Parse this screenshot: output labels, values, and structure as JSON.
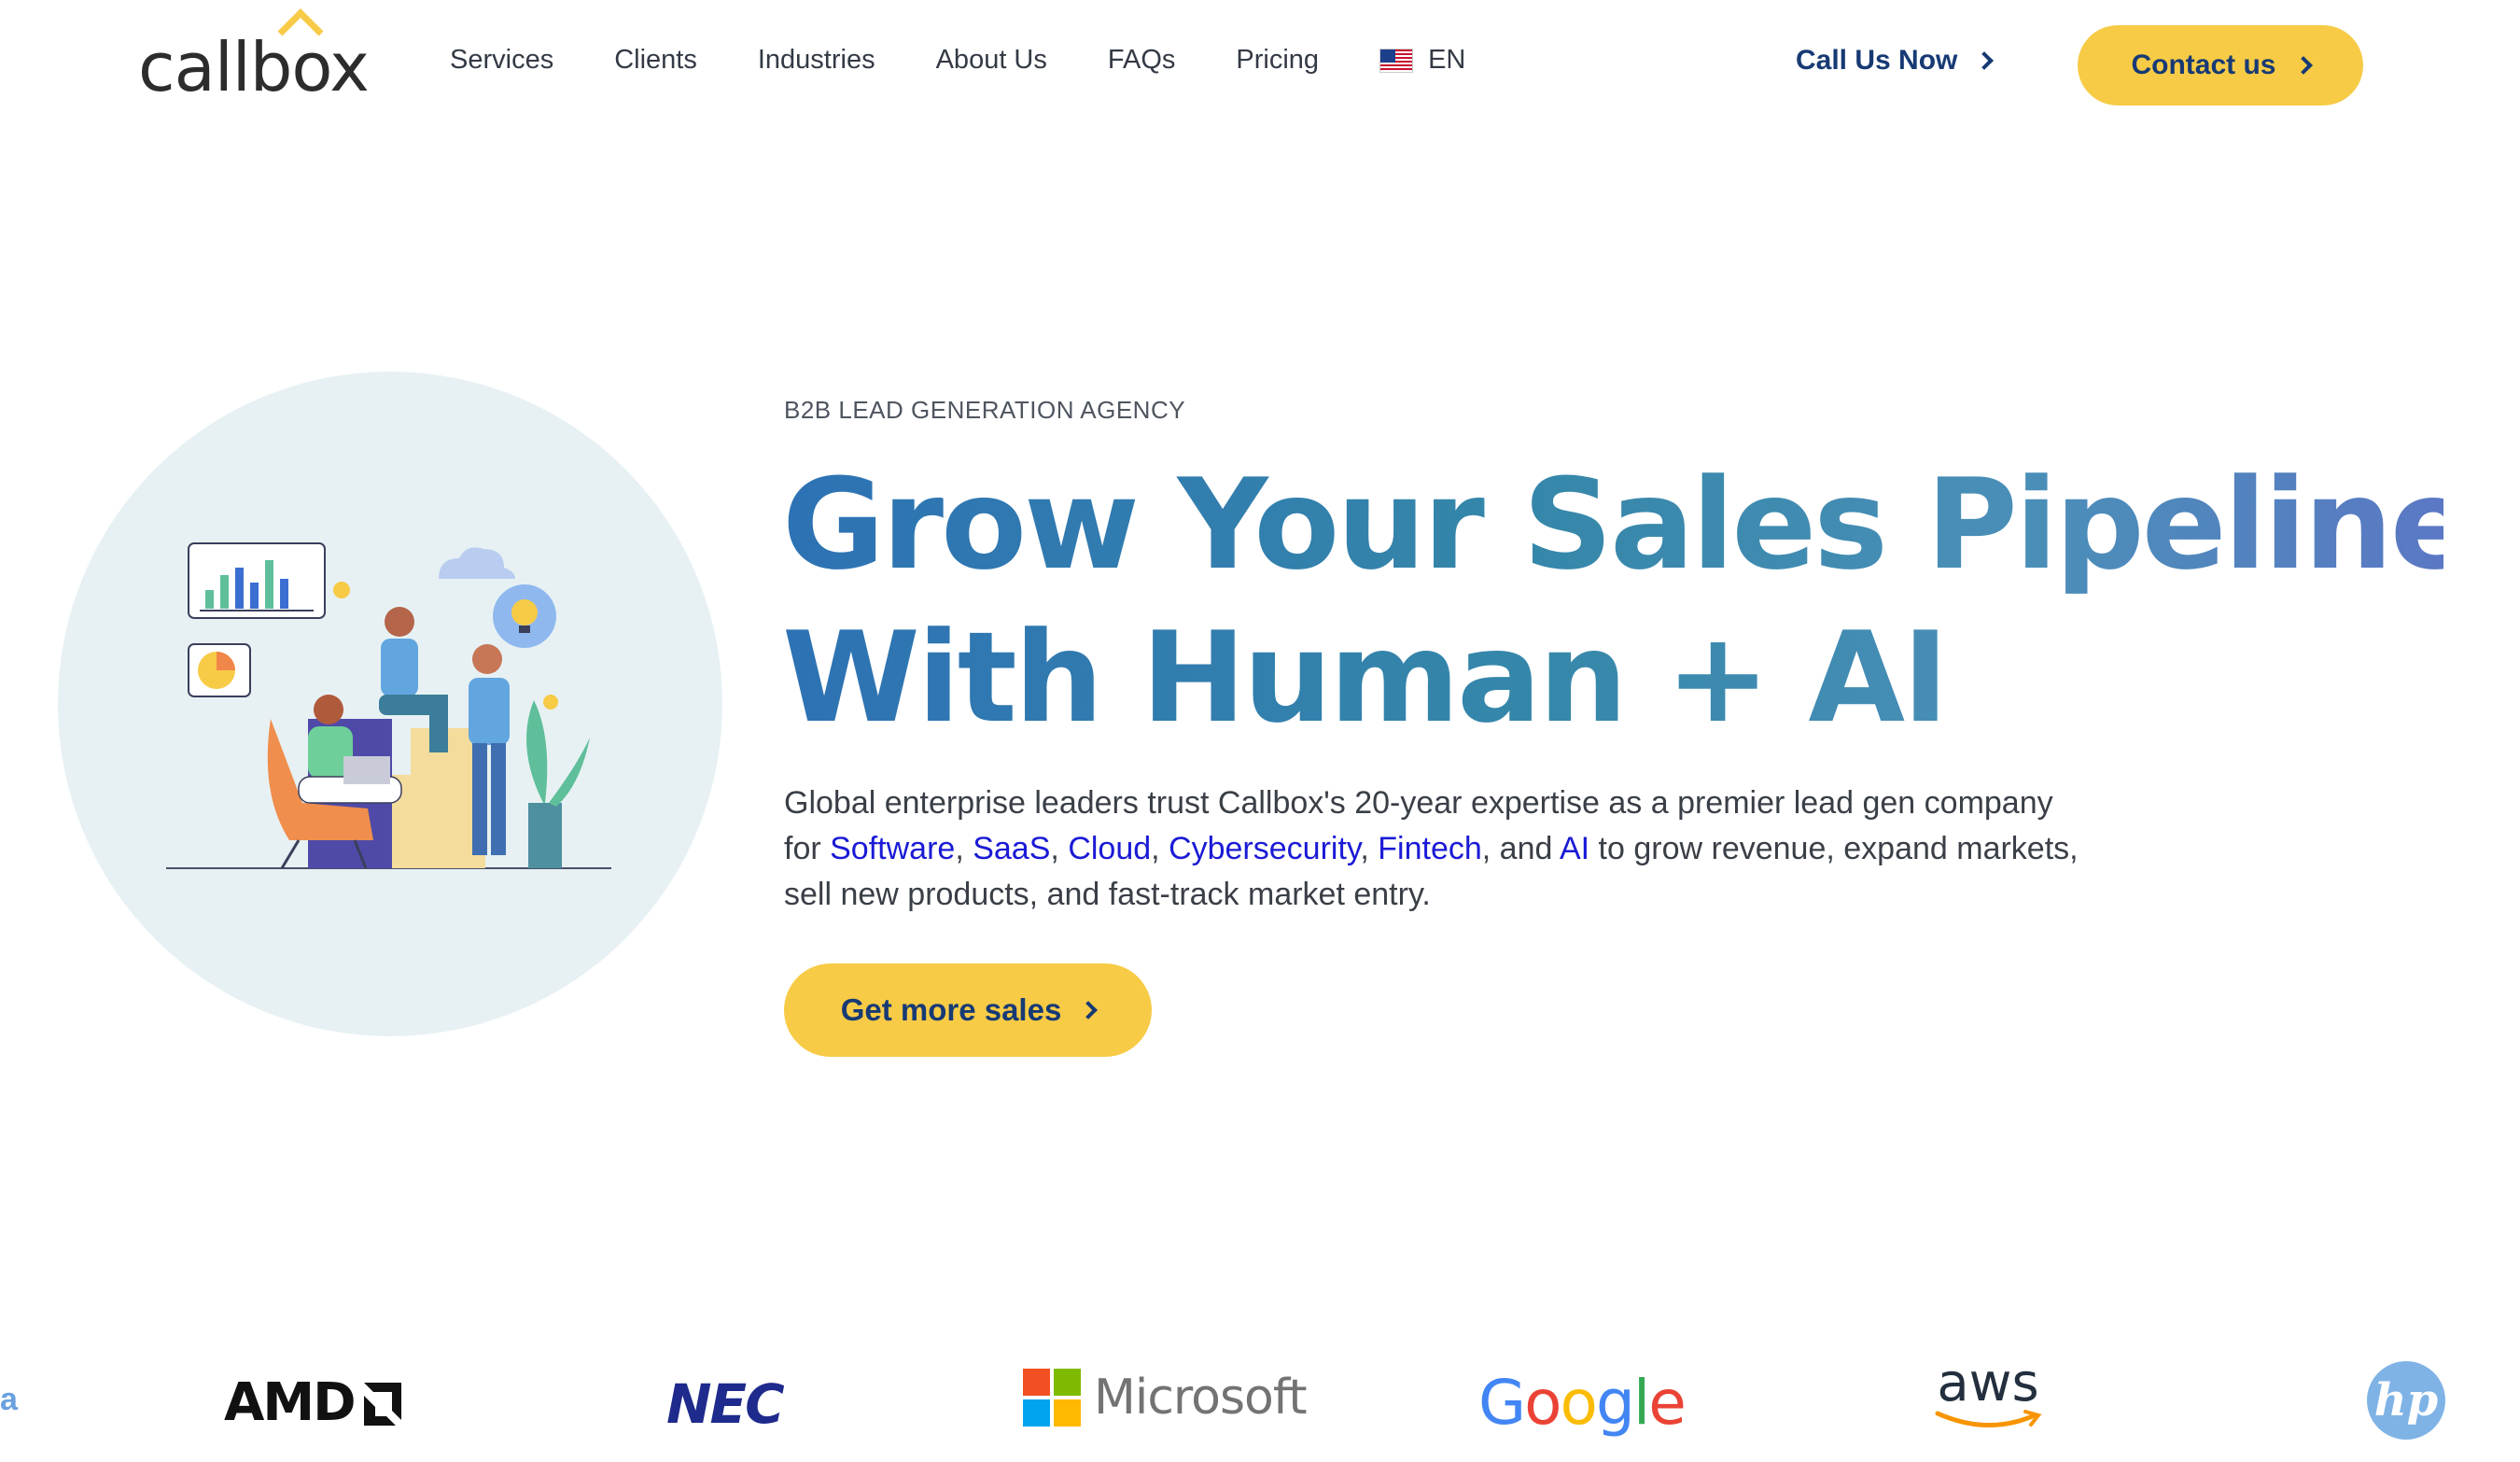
{
  "brand": {
    "name": "callbox",
    "accent": "#f7cb46",
    "navy": "#173a74"
  },
  "nav": {
    "items": [
      {
        "label": "Services"
      },
      {
        "label": "Clients"
      },
      {
        "label": "Industries"
      },
      {
        "label": "About Us"
      },
      {
        "label": "FAQs"
      },
      {
        "label": "Pricing"
      }
    ],
    "language": {
      "label": "EN",
      "icon": "us-flag-icon"
    },
    "call_label": "Call Us Now",
    "contact_label": "Contact us"
  },
  "hero": {
    "eyebrow": "B2B LEAD GENERATION AGENCY",
    "headline_line1": "Grow Your Sales Pipeline",
    "headline_line2": "With Human + AI",
    "lead": {
      "intro": "Global enterprise leaders trust Callbox's 20-year expertise as a premier lead gen company for ",
      "links": [
        "Software",
        "SaaS",
        "Cloud",
        "Cybersecurity",
        "Fintech",
        "AI"
      ],
      "sep1": ", ",
      "sep2": ", ",
      "sep3": ", ",
      "sep4": ", ",
      "sep5": ", and ",
      "outro": " to grow revenue, expand markets, sell new products, and fast-track market entry."
    },
    "cta_label": "Get more sales",
    "illustration": "team-analytics-illustration"
  },
  "client_logos": {
    "partial": "a",
    "items": [
      {
        "name": "AMD"
      },
      {
        "name": "NEC"
      },
      {
        "name": "Microsoft"
      },
      {
        "name": "Google"
      },
      {
        "name": "aws"
      },
      {
        "name": "hp"
      }
    ]
  }
}
